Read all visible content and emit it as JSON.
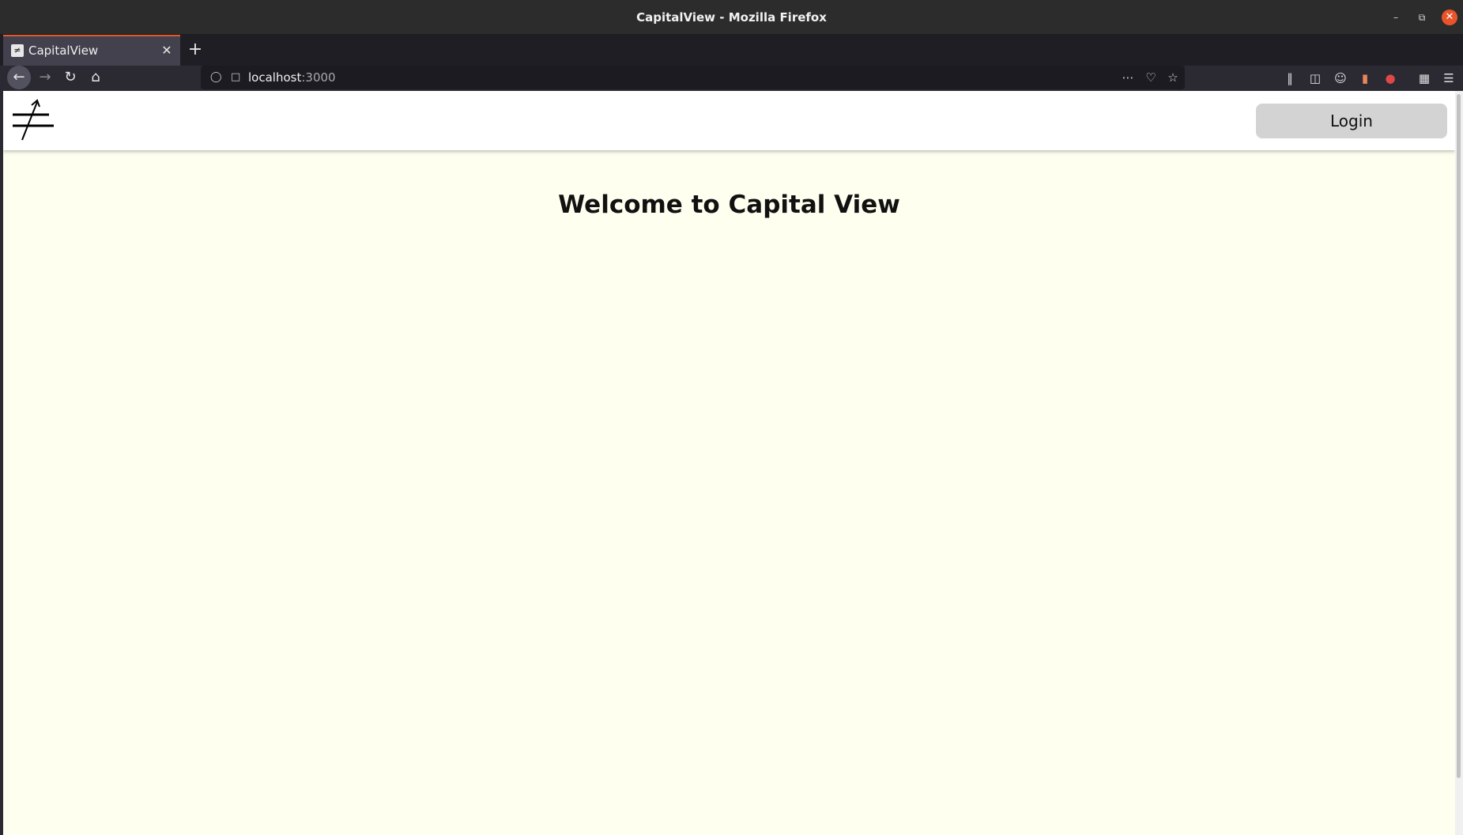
{
  "window": {
    "title": "CapitalView - Mozilla Firefox"
  },
  "tabs": [
    {
      "label": "CapitalView"
    }
  ],
  "address_bar": {
    "host": "localhost",
    "port": ":3000"
  },
  "toolbar_icons": [
    "library-icon",
    "sidebar-icon",
    "account-icon",
    "extension-icon",
    "extension-red-icon",
    "extensions-icon",
    "menu-icon"
  ],
  "site": {
    "login_label": "Login",
    "heading": "Welcome to Capital View"
  },
  "colors": {
    "page_background": "#fffff0",
    "header_background": "#ffffff",
    "login_button": "#d3d3d3",
    "tab_accent": "#e05a2b"
  }
}
